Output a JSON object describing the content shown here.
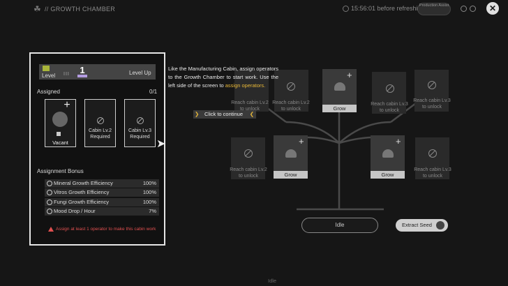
{
  "header": {
    "breadcrumb": "// GROWTH CHAMBER",
    "refresh_text": "15:56:01 before refreshing",
    "production_label": "Production Assist"
  },
  "panel": {
    "level_label": "Level",
    "level_bars": "III",
    "level_value": "1",
    "level_up": "Level Up",
    "assigned_title": "Assigned",
    "assigned_count": "0/1",
    "slots": [
      {
        "label": "Vacant"
      },
      {
        "label": "Cabin Lv.2 Required"
      },
      {
        "label": "Cabin Lv.3 Required"
      }
    ],
    "bonus_title": "Assignment Bonus",
    "bonus_rows": [
      {
        "label": "Mineral Growth Efficiency",
        "value": "100%"
      },
      {
        "label": "Vitros Growth Efficiency",
        "value": "100%"
      },
      {
        "label": "Fungi Growth Efficiency",
        "value": "100%"
      },
      {
        "label": "Mood Drop / Hour",
        "value": "7%"
      }
    ],
    "warning": "Assign at least 1 operator to make this cabin work"
  },
  "tooltip": {
    "text": "Like the Manufacturing Cabin, assign operators to the Growth Chamber to start work. Use the left side of the screen to",
    "highlight": "assign operators.",
    "continue": "Click to continue"
  },
  "tree": {
    "reach_lv2": "Reach cabin Lv.2 to unlock",
    "reach_lv3": "Reach cabin Lv.3 to unlock",
    "grow": "Grow"
  },
  "actions": {
    "idle": "Idle",
    "extract": "Extract Seed",
    "bottom_status": "Idle"
  }
}
